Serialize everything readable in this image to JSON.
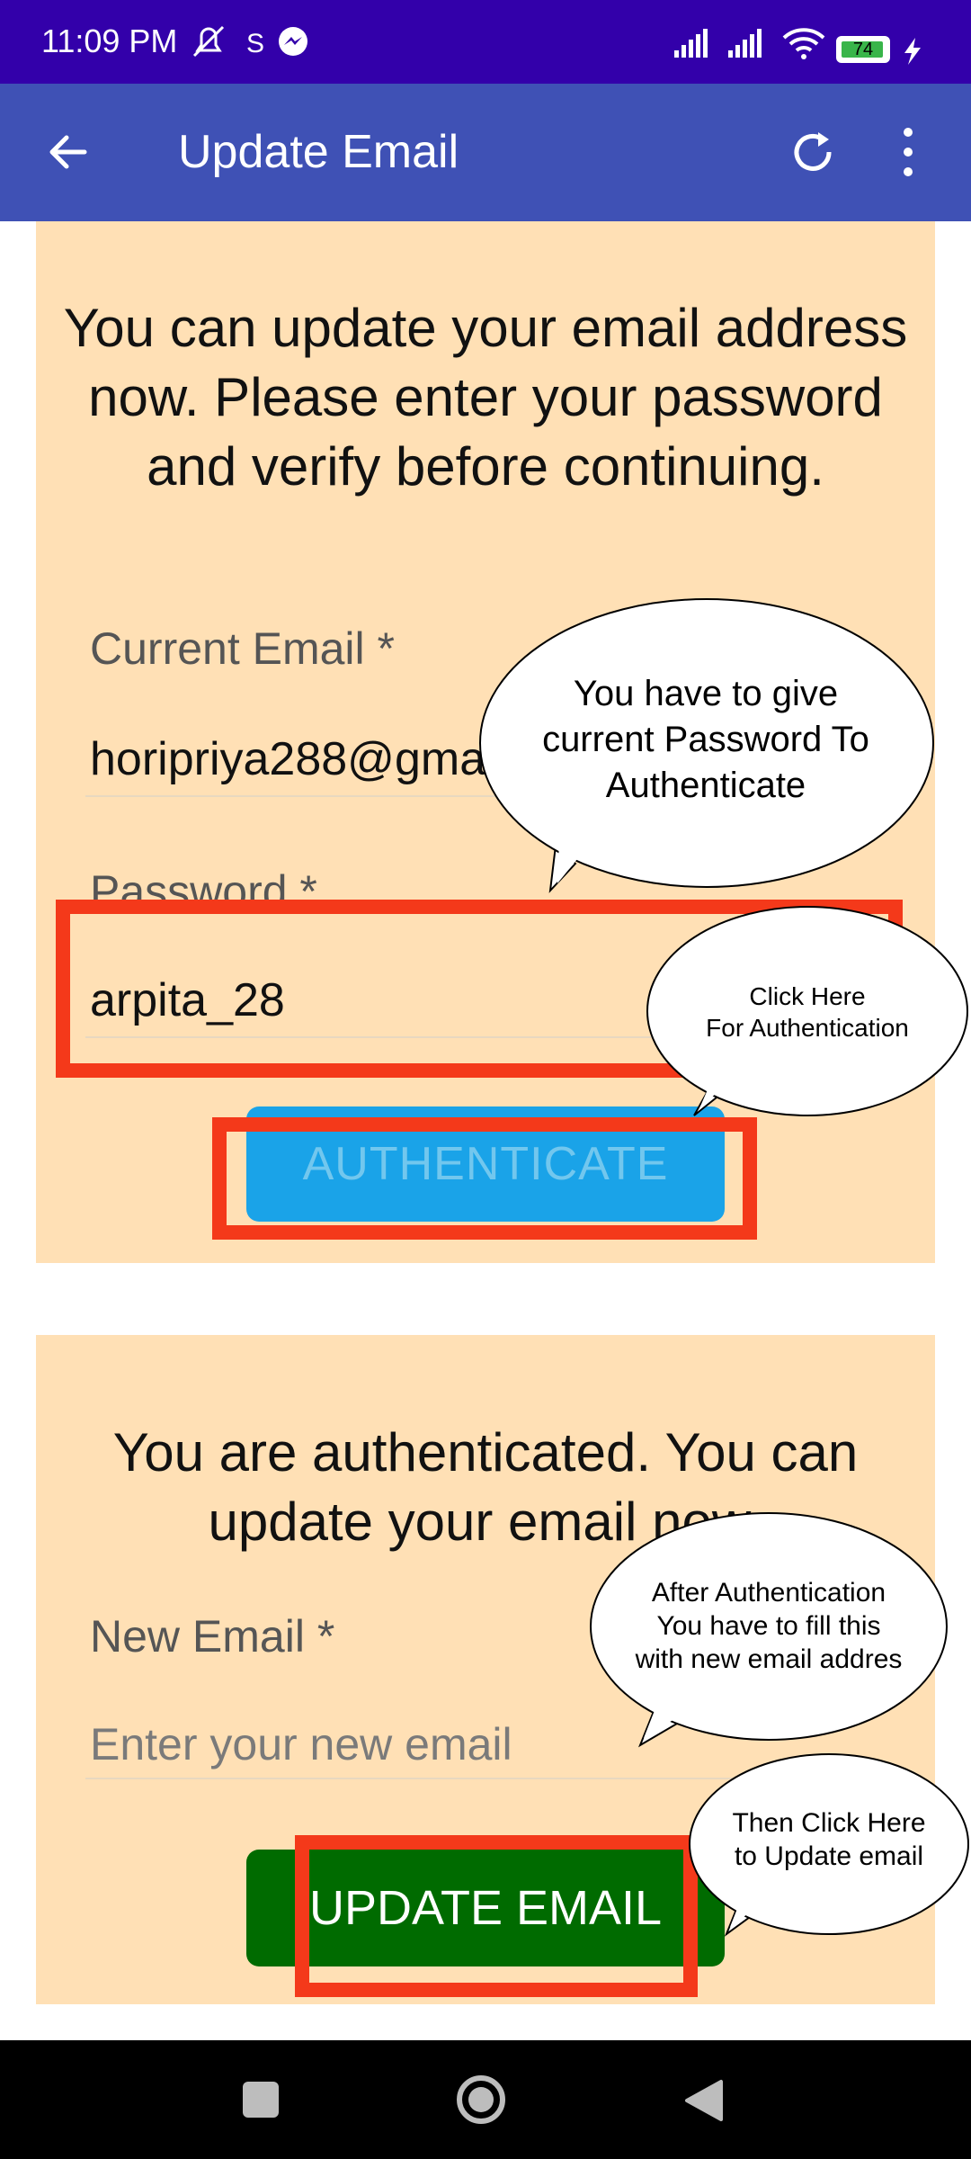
{
  "status_bar": {
    "time": "11:09 PM",
    "battery": "74"
  },
  "app_bar": {
    "title": "Update Email"
  },
  "auth_card": {
    "intro": "You can update your email address now. Please enter your password and verify before continuing.",
    "current_email_label": "Current Email *",
    "current_email_value": "horipriya288@gma",
    "password_label": "Password *",
    "password_value": "arpita_28",
    "authenticate_label": "AUTHENTICATE"
  },
  "update_card": {
    "intro": "You are authenticated. You can update your email now.",
    "new_email_label": "New Email *",
    "new_email_placeholder": "Enter your new email",
    "update_label": "UPDATE EMAIL"
  },
  "callouts": {
    "password_hint": "You have to give current Password To Authenticate",
    "auth_hint_line1": "Click Here",
    "auth_hint_line2": "For Authentication",
    "new_email_hint_line1": "After Authentication",
    "new_email_hint_line2": "You have to fill this",
    "new_email_hint_line3": "with new email addres",
    "update_hint_line1": "Then Click Here",
    "update_hint_line2": "to Update email"
  },
  "colors": {
    "status_bar": "#3300aa",
    "app_bar": "#3f51b5",
    "card": "#ffe0b5",
    "authenticate_button": "#1aa3e8",
    "update_button": "#006b00",
    "highlight": "#f4391a"
  },
  "icons": [
    "back-arrow-icon",
    "refresh-icon",
    "overflow-menu-icon",
    "mute-icon",
    "messenger-icon",
    "signal-icon",
    "wifi-icon",
    "battery-icon",
    "recents-icon",
    "home-icon",
    "back-nav-icon"
  ]
}
